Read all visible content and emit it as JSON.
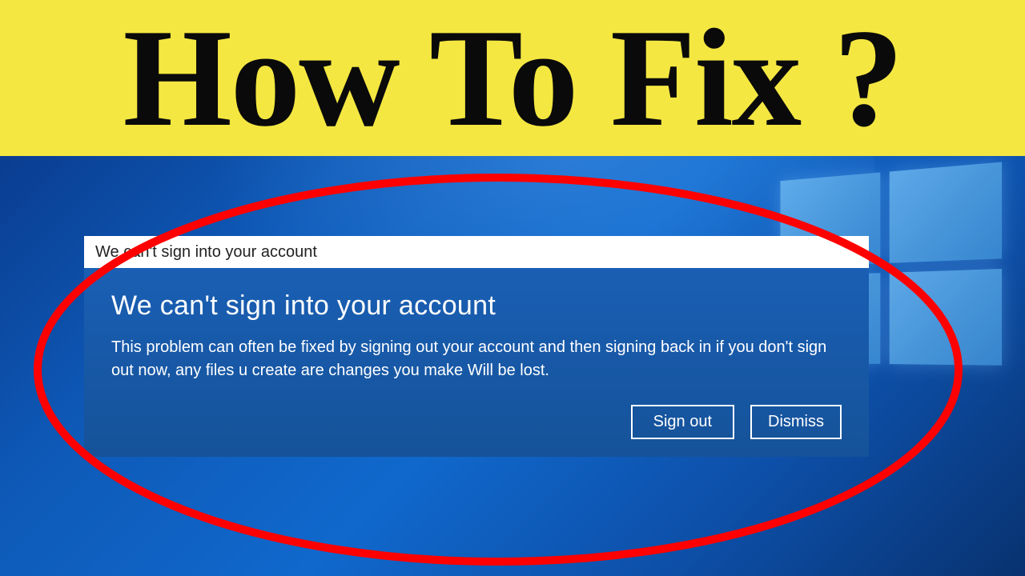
{
  "banner": {
    "headline": "How To Fix ?"
  },
  "dialog": {
    "titlebar": "We can't sign into your account",
    "heading": "We can't sign into your account",
    "message": "This problem can often be fixed by signing out your account and then signing back in if you don't sign out now, any files u create are changes you make Will be lost.",
    "signout_label": "Sign out",
    "dismiss_label": "Dismiss"
  },
  "annotation": {
    "ellipse_stroke": "#ff0000",
    "ellipse_stroke_width": 10
  }
}
